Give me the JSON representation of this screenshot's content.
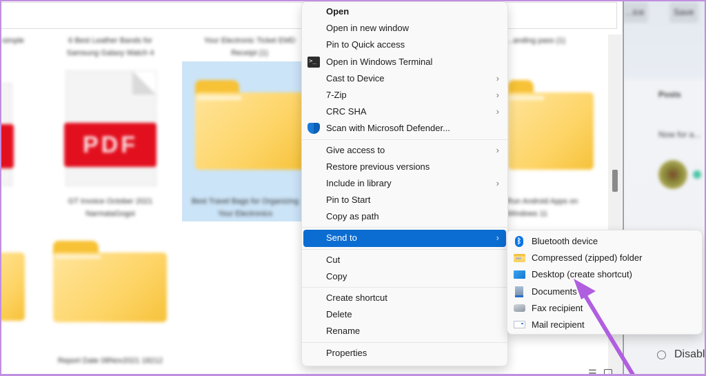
{
  "explorer": {
    "files": [
      {
        "name": "...o simple",
        "type": "document"
      },
      {
        "name": "6 Best Leather Bands for Samsung Galaxy Watch 4",
        "type": "pdf"
      },
      {
        "name": "Your Electronic Ticket EMD Receipt (1)",
        "type": "folder"
      },
      {
        "name": "...anding pass (1)",
        "type": "folder"
      },
      {
        "name": "GT Invoice October 2021 NarmataGogoi",
        "type": "pdf",
        "badge": "PDF"
      },
      {
        "name": "Best Travel Bags for Organizing Your Electronics",
        "type": "folder",
        "selected": true
      },
      {
        "name": "Run Android Apps on Windows 11",
        "type": "folder"
      },
      {
        "name": "Report Date 08Nov2021 18212",
        "type": "folder"
      }
    ]
  },
  "side_app": {
    "buttons": [
      "...ice",
      "Save"
    ],
    "heading": "Posts",
    "subtext": "Now for a...",
    "option": "Disabl..."
  },
  "context_menu": {
    "groups": [
      [
        {
          "label": "Open",
          "bold": true
        },
        {
          "label": "Open in new window"
        },
        {
          "label": "Pin to Quick access"
        },
        {
          "label": "Open in Windows Terminal",
          "icon": "terminal-icon"
        },
        {
          "label": "Cast to Device",
          "submenu": true
        },
        {
          "label": "7-Zip",
          "submenu": true
        },
        {
          "label": "CRC SHA",
          "submenu": true
        },
        {
          "label": "Scan with Microsoft Defender...",
          "icon": "defender-shield-icon"
        }
      ],
      [
        {
          "label": "Give access to",
          "submenu": true
        },
        {
          "label": "Restore previous versions"
        },
        {
          "label": "Include in library",
          "submenu": true
        },
        {
          "label": "Pin to Start"
        },
        {
          "label": "Copy as path"
        }
      ],
      [
        {
          "label": "Send to",
          "submenu": true,
          "active": true
        }
      ],
      [
        {
          "label": "Cut"
        },
        {
          "label": "Copy"
        }
      ],
      [
        {
          "label": "Create shortcut"
        },
        {
          "label": "Delete"
        },
        {
          "label": "Rename"
        }
      ],
      [
        {
          "label": "Properties"
        }
      ]
    ],
    "chevron": "›",
    "active_color": "#0b6dd1"
  },
  "send_to_menu": {
    "items": [
      {
        "label": "Bluetooth device",
        "icon": "bluetooth-icon"
      },
      {
        "label": "Compressed (zipped) folder",
        "icon": "zip-folder-icon"
      },
      {
        "label": "Desktop (create shortcut)",
        "icon": "desktop-icon"
      },
      {
        "label": "Documents",
        "icon": "documents-icon"
      },
      {
        "label": "Fax recipient",
        "icon": "fax-icon"
      },
      {
        "label": "Mail recipient",
        "icon": "mail-icon"
      }
    ]
  },
  "annotation": {
    "type": "arrow",
    "color": "#b05ee0",
    "points_to": "Desktop (create shortcut)"
  }
}
